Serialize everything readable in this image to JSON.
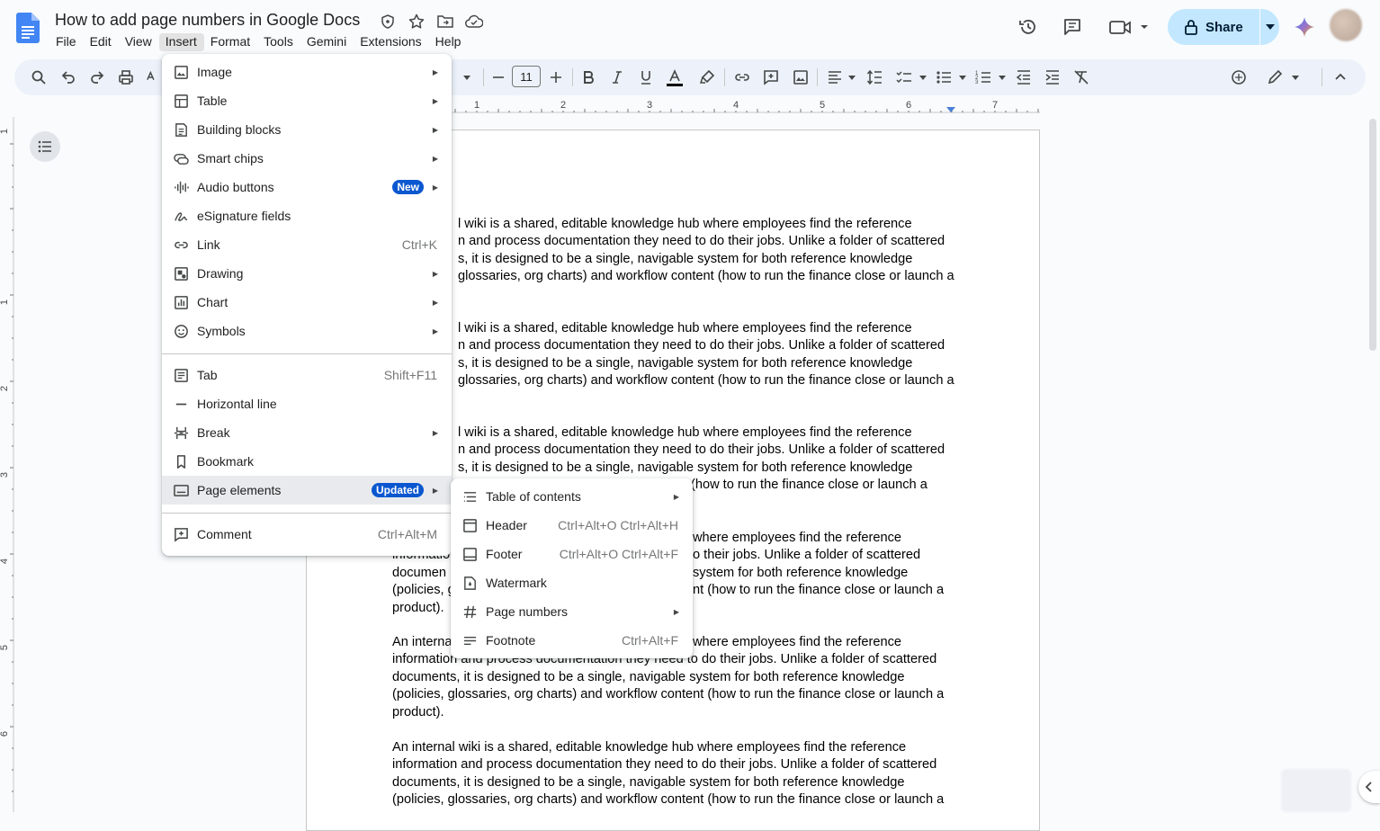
{
  "doc": {
    "title": "How to add page numbers in Google Docs"
  },
  "menubar": [
    "File",
    "Edit",
    "View",
    "Insert",
    "Format",
    "Tools",
    "Gemini",
    "Extensions",
    "Help"
  ],
  "share": {
    "label": "Share"
  },
  "toolbar": {
    "font_size": "11"
  },
  "ruler": {
    "h_numbers": [
      "1",
      "2",
      "3",
      "4",
      "5",
      "6",
      "7"
    ],
    "v_numbers": [
      "1",
      "1",
      "2",
      "3",
      "4",
      "5",
      "6"
    ]
  },
  "insert_menu": {
    "items": [
      {
        "label": "Image",
        "icon": "image-icon",
        "arrow": true
      },
      {
        "label": "Table",
        "icon": "table-icon",
        "arrow": true
      },
      {
        "label": "Building blocks",
        "icon": "building-blocks-icon",
        "arrow": true
      },
      {
        "label": "Smart chips",
        "icon": "smart-chips-icon",
        "arrow": true
      },
      {
        "label": "Audio buttons",
        "icon": "audio-icon",
        "arrow": true,
        "badge": "New"
      },
      {
        "label": "eSignature fields",
        "icon": "esignature-icon"
      },
      {
        "label": "Link",
        "icon": "link-icon",
        "shortcut": "Ctrl+K"
      },
      {
        "label": "Drawing",
        "icon": "drawing-icon",
        "arrow": true
      },
      {
        "label": "Chart",
        "icon": "chart-icon",
        "arrow": true
      },
      {
        "label": "Symbols",
        "icon": "symbols-icon",
        "arrow": true
      },
      {
        "label": "Tab",
        "icon": "tab-icon",
        "shortcut": "Shift+F11"
      },
      {
        "label": "Horizontal line",
        "icon": "horizontal-line-icon"
      },
      {
        "label": "Break",
        "icon": "break-icon",
        "arrow": true
      },
      {
        "label": "Bookmark",
        "icon": "bookmark-icon"
      },
      {
        "label": "Page elements",
        "icon": "page-elements-icon",
        "arrow": true,
        "badge": "Updated"
      },
      {
        "label": "Comment",
        "icon": "comment-icon",
        "shortcut": "Ctrl+Alt+M"
      }
    ]
  },
  "page_elements_menu": {
    "items": [
      {
        "label": "Table of contents",
        "icon": "toc-icon",
        "arrow": true
      },
      {
        "label": "Header",
        "icon": "header-icon",
        "shortcut": "Ctrl+Alt+O Ctrl+Alt+H"
      },
      {
        "label": "Footer",
        "icon": "footer-icon",
        "shortcut": "Ctrl+Alt+O Ctrl+Alt+F"
      },
      {
        "label": "Watermark",
        "icon": "watermark-icon"
      },
      {
        "label": "Page numbers",
        "icon": "hash-icon",
        "arrow": true
      },
      {
        "label": "Footnote",
        "icon": "footnote-icon",
        "shortcut": "Ctrl+Alt+F"
      }
    ]
  },
  "body": {
    "p1": [
      "l wiki is a shared, editable knowledge hub where employees find the reference",
      "n and process documentation they need to do their jobs. Unlike a folder of scattered",
      "s, it is designed to be a single, navigable system for both reference knowledge",
      "glossaries, org charts) and workflow content (how to run the finance close or launch a"
    ],
    "p2": [
      "l wiki is a shared, editable knowledge hub where employees find the reference",
      "n and process documentation they need to do their jobs. Unlike a folder of scattered",
      "s, it is designed to be a single, navigable system for both reference knowledge",
      "glossaries, org charts) and workflow content (how to run the finance close or launch a"
    ],
    "p3": [
      "l wiki is a shared, editable knowledge hub where employees find the reference",
      "n and process documentation they need to do their jobs. Unlike a folder of scattered",
      "s, it is designed to be a single, navigable system for both reference knowledge",
      "(how to run the finance close or launch a"
    ],
    "p4": [
      "where employees find the reference",
      "informatio",
      "o their jobs. Unlike a folder of scattered",
      "documen",
      "system for both reference knowledge",
      "(policies, g",
      "nt (how to run the finance close or launch a",
      "product)."
    ],
    "p5": [
      "An interna",
      "where employees find the reference",
      "information and process documentation they need to do their jobs. Unlike a folder of scattered",
      "documents, it is designed to be a single, navigable system for both reference knowledge",
      "(policies, glossaries, org charts) and workflow content (how to run the finance close or launch a",
      "product)."
    ],
    "p6": [
      "An internal wiki is a shared, editable knowledge hub where employees find the reference",
      "information and process documentation they need to do their jobs. Unlike a folder of scattered",
      "documents, it is designed to be a single, navigable system for both reference knowledge",
      "(policies, glossaries, org charts) and workflow content (how to run the finance close or launch a"
    ]
  }
}
